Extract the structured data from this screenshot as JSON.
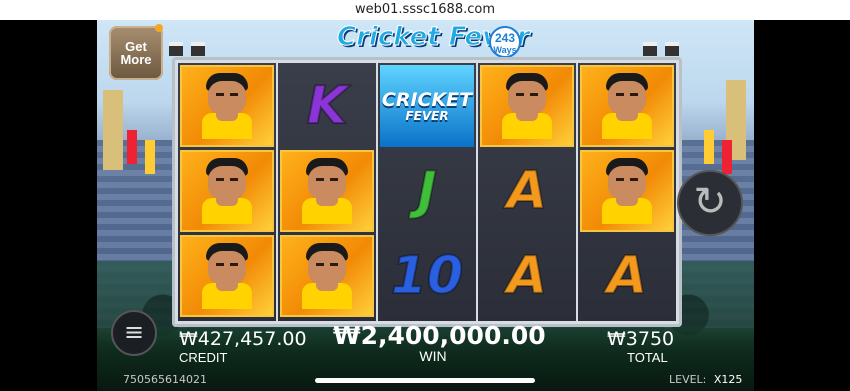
{
  "browser": {
    "url": "web01.sssc1688.com"
  },
  "header": {
    "title": "Cricket Fever",
    "ways_number": "243",
    "ways_label": "Ways"
  },
  "get_more": {
    "line1": "Get",
    "line2": "More"
  },
  "reels": [
    [
      "player",
      "player",
      "player"
    ],
    [
      "K",
      "player",
      "player"
    ],
    [
      "logo",
      "J",
      "10"
    ],
    [
      "player",
      "A",
      "A"
    ],
    [
      "player",
      "player",
      "A"
    ]
  ],
  "logo_symbol": {
    "line1": "CRICKET",
    "line2": "FEVER"
  },
  "symbol_colors": {
    "K": "#8b35d6",
    "J": "#3fbf3a",
    "10": "#2a5fe0",
    "A": "#f39a1e"
  },
  "stats": {
    "credit": {
      "value": "₩427,457.00",
      "label": "CREDIT"
    },
    "win": {
      "value": "₩2,400,000.00",
      "label": "WIN"
    },
    "total": {
      "value": "₩3750",
      "label": "TOTAL"
    }
  },
  "footer": {
    "id": "750565614021",
    "level_label": "LEVEL:",
    "level_value": "X125"
  },
  "icons": {
    "spin": "spin-refresh-icon",
    "menu": "hamburger-menu-icon"
  }
}
